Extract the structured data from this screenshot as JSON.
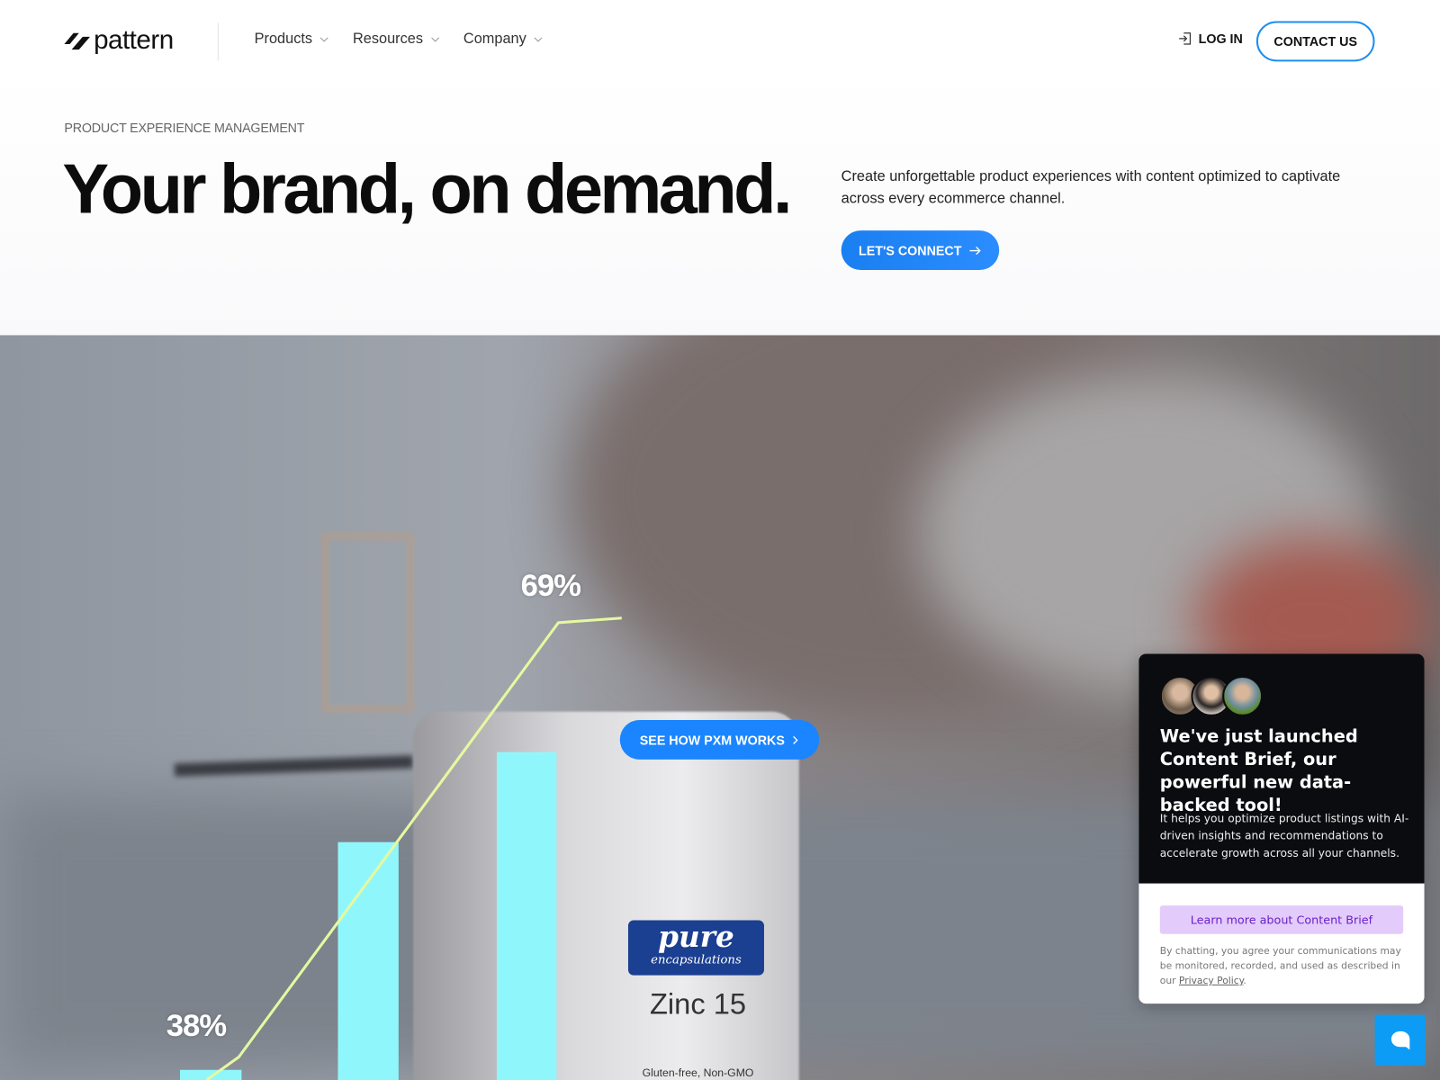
{
  "header": {
    "logo_text": "pattern",
    "nav": [
      {
        "label": "Products"
      },
      {
        "label": "Resources"
      },
      {
        "label": "Company"
      }
    ],
    "login_label": "LOG IN",
    "contact_label": "CONTACT US"
  },
  "hero": {
    "eyebrow": "PRODUCT EXPERIENCE MANAGEMENT",
    "headline": "Your brand, on demand.",
    "subtext": "Create unforgettable product experiences with content optimized to captivate across every ecommerce channel.",
    "cta_label": "LET'S CONNECT",
    "video_cta_label": "SEE HOW PXM WORKS",
    "overlay_stats": [
      "38%",
      "69%"
    ],
    "product_label": {
      "brand": "pure",
      "sub": "encapsulations",
      "name": "Zinc 15",
      "note": "Gluten-free, Non-GMO"
    }
  },
  "chat_widget": {
    "title": "We've just launched Content Brief, our powerful new data-backed tool!",
    "body": "It helps you optimize product listings with AI-driven insights and recommendations to accelerate growth across all your channels.",
    "learn_more_label": "Learn more about Content Brief",
    "legal_prefix": "By chatting, you agree your communications may be monitored, recorded, and used as described in our ",
    "privacy_link": "Privacy Policy",
    "legal_suffix": "."
  },
  "colors": {
    "accent": "#1a85ff",
    "chat_bg": "#0b0c10",
    "learn_bg": "#e3ccfb",
    "bar": "#8ff7fb"
  }
}
